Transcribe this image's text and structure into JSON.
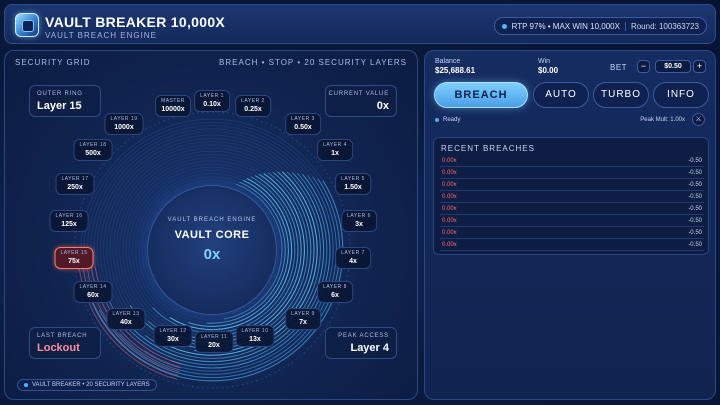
{
  "header": {
    "title": "VAULT BREAKER 10,000X",
    "subtitle": "VAULT BREACH ENGINE",
    "rtp_text": "RTP 97% • MAX WIN 10,000X",
    "round_text": "Round: 100363723"
  },
  "grid": {
    "title": "SECURITY GRID",
    "info": "BREACH • STOP • 20 SECURITY LAYERS",
    "outer_ring_label": "OUTER RING",
    "outer_ring_value": "Layer 15",
    "current_value_label": "CURRENT VALUE",
    "current_value": "0x",
    "last_breach_label": "LAST BREACH",
    "last_breach_value": "Lockout",
    "peak_access_label": "PEAK ACCESS",
    "peak_access_value": "Layer 4",
    "core_label": "VAULT BREACH ENGINE",
    "core_title": "VAULT CORE",
    "core_value": "0x",
    "footer": "VAULT BREAKER • 20 SECURITY LAYERS",
    "active_layer": "LAYER 15",
    "layers": [
      {
        "label": "MASTER",
        "value": "10000x"
      },
      {
        "label": "LAYER 1",
        "value": "0.10x"
      },
      {
        "label": "LAYER 2",
        "value": "0.25x"
      },
      {
        "label": "LAYER 3",
        "value": "0.50x"
      },
      {
        "label": "LAYER 4",
        "value": "1x"
      },
      {
        "label": "LAYER 5",
        "value": "1.50x"
      },
      {
        "label": "LAYER 6",
        "value": "3x"
      },
      {
        "label": "LAYER 7",
        "value": "4x"
      },
      {
        "label": "LAYER 8",
        "value": "6x"
      },
      {
        "label": "LAYER 9",
        "value": "7x"
      },
      {
        "label": "LAYER 10",
        "value": "13x"
      },
      {
        "label": "LAYER 11",
        "value": "20x"
      },
      {
        "label": "LAYER 12",
        "value": "30x"
      },
      {
        "label": "LAYER 13",
        "value": "40x"
      },
      {
        "label": "LAYER 14",
        "value": "60x"
      },
      {
        "label": "LAYER 15",
        "value": "75x"
      },
      {
        "label": "LAYER 16",
        "value": "125x"
      },
      {
        "label": "LAYER 17",
        "value": "250x"
      },
      {
        "label": "LAYER 18",
        "value": "500x"
      },
      {
        "label": "LAYER 19",
        "value": "1000x"
      }
    ]
  },
  "controls": {
    "balance_label": "Balance",
    "balance_value": "$25,688.61",
    "win_label": "Win",
    "win_value": "$0.00",
    "bet_label": "BET",
    "bet_minus": "−",
    "bet_value": "$0.50",
    "bet_plus": "+",
    "breach_button": "BREACH",
    "auto_button": "AUTO",
    "turbo_button": "TURBO",
    "info_button": "INFO",
    "status_text": "Ready",
    "peak_mult": "Peak Mult: 1.00x",
    "peak_icon": "⚔"
  },
  "recent": {
    "title": "RECENT BREACHES",
    "rows": [
      {
        "mult": "0.00x",
        "profit": "-0.50"
      },
      {
        "mult": "0.00x",
        "profit": "-0.50"
      },
      {
        "mult": "0.00x",
        "profit": "-0.50"
      },
      {
        "mult": "0.00x",
        "profit": "-0.50"
      },
      {
        "mult": "0.00x",
        "profit": "-0.50"
      },
      {
        "mult": "0.00x",
        "profit": "-0.50"
      },
      {
        "mult": "0.00x",
        "profit": "-0.50"
      },
      {
        "mult": "0.00x",
        "profit": "-0.50"
      }
    ]
  },
  "colors": {
    "accent": "#7fd0ff",
    "loss": "#ff6b7d",
    "active_ring": "#ff7a6a"
  }
}
